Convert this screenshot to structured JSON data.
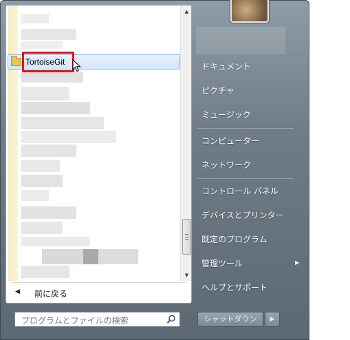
{
  "programs": {
    "highlighted_item": {
      "label": "TortoiseGit",
      "icon": "folder-icon"
    }
  },
  "back": {
    "arrow_icon": "left-triangle-icon",
    "label": "前に戻る"
  },
  "search": {
    "placeholder": "プログラムとファイルの検索",
    "icon": "search-icon"
  },
  "right_menu": {
    "items": [
      {
        "label": "ドキュメント"
      },
      {
        "label": "ピクチャ"
      },
      {
        "label": "ミュージック"
      },
      {
        "label": "コンピューター"
      },
      {
        "label": "ネットワーク"
      },
      {
        "label": "コントロール パネル"
      },
      {
        "label": "デバイスとプリンター"
      },
      {
        "label": "既定のプログラム"
      },
      {
        "label": "管理ツール"
      },
      {
        "label": "ヘルプとサポート"
      }
    ]
  },
  "shutdown": {
    "label": "シャットダウン",
    "options_icon": "right-triangle-icon"
  },
  "colors": {
    "highlight_border": "#e0141a",
    "selection_bg": "#d3e6fb",
    "menu_frame": "#6f7c87"
  }
}
